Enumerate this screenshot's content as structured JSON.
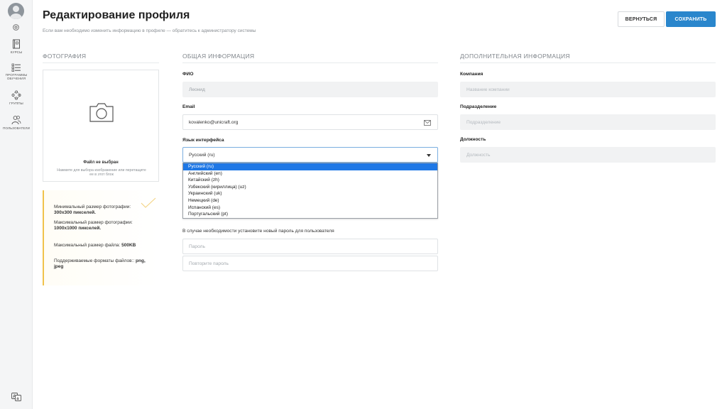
{
  "sidebar": {
    "items": [
      {
        "label": "Курсы",
        "icon": "book-icon"
      },
      {
        "label": "Программы обучения",
        "icon": "list-icon"
      },
      {
        "label": "Группы",
        "icon": "groups-icon"
      },
      {
        "label": "Пользователи",
        "icon": "users-icon"
      }
    ],
    "language_icon": "language-icon"
  },
  "header": {
    "title": "Редактирование профиля",
    "subtitle": "Если вам необходимо изменить информацию в профиле — обратитесь к администратору системы",
    "back_label": "ВЕРНУТЬСЯ",
    "save_label": "СОХРАНИТЬ"
  },
  "photo": {
    "section_title": "ФОТОГРАФИЯ",
    "no_file": "Файл не выбран",
    "hint": "Нажмите для выбора изображение или перетащите ее в этот блок"
  },
  "photo_info": {
    "min_size_label": "Минимальный размер фотографии: ",
    "min_size_value": "300x300 пикселей.",
    "max_size_label": "Максимальный размер фотографии: ",
    "max_size_value": "1000x1000 пикселей.",
    "max_file_label": "Максимальный размер файла: ",
    "max_file_value": "500KB",
    "formats_label": "Поддерживаемые форматы файлов:: ",
    "formats_value": "png, jpeg"
  },
  "general": {
    "section_title": "ОБЩАЯ ИНФОРМАЦИЯ",
    "fio_label": "ФИО",
    "fio_value": "Леонид",
    "email_label": "Email",
    "email_value": "kovalenko@unicraft.org",
    "lang_label": "Язык интерфейса",
    "lang_value": "Русский (ru)",
    "lang_options": [
      "Русский (ru)",
      "Английский (en)",
      "Китайский (zh)",
      "Узбекский (кириллица) (uz)",
      "Украинский (uk)",
      "Немецкий (de)",
      "Испанский (es)",
      "Португальский (pt)"
    ],
    "password_note": "В случае необходимости установите новый пароль для пользователя",
    "password_placeholder": "Пароль",
    "password_repeat_placeholder": "Повторите пароль"
  },
  "additional": {
    "section_title": "ДОПОЛНИТЕЛЬНАЯ ИНФОРМАЦИЯ",
    "company_label": "Компания",
    "company_placeholder": "Название компании",
    "department_label": "Подразделение",
    "department_placeholder": "Подразделение",
    "position_label": "Должность",
    "position_placeholder": "Должность"
  },
  "colors": {
    "accent": "#2a86cc",
    "selected_option": "#1e78e6",
    "info_border": "#f0c24b"
  }
}
